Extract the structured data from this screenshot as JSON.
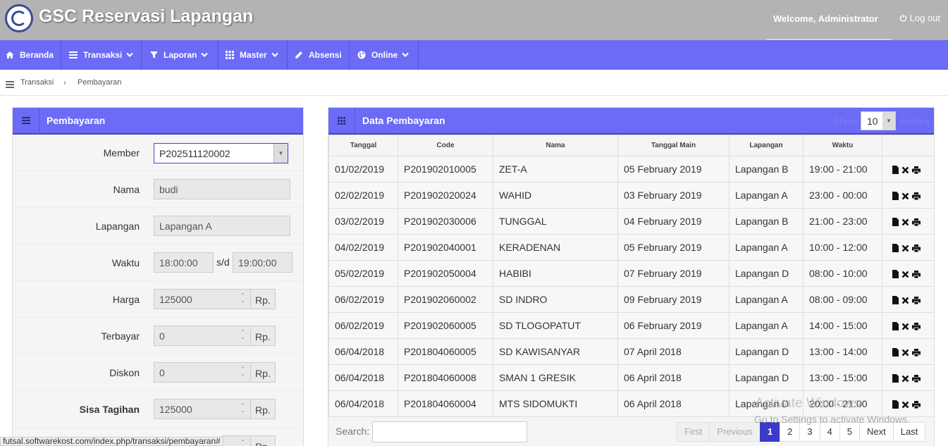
{
  "app": {
    "title": "GSC Reservasi Lapangan",
    "welcome": "Welcome, Administrator",
    "logout": "Log out"
  },
  "nav": [
    {
      "label": "Beranda",
      "icon": "home-icon"
    },
    {
      "label": "Transaksi",
      "icon": "list-icon"
    },
    {
      "label": "Laporan",
      "icon": "filter-icon"
    },
    {
      "label": "Master",
      "icon": "grid-icon"
    },
    {
      "label": "Absensi",
      "icon": "pencil-icon"
    },
    {
      "label": "Online",
      "icon": "globe-icon"
    }
  ],
  "breadcrumb": [
    "Transaksi",
    "Pembayaran"
  ],
  "form": {
    "title": "Pembayaran",
    "member_label": "Member",
    "member_value": "P202511120002",
    "nama_label": "Nama",
    "nama_value": "budi",
    "lapangan_label": "Lapangan",
    "lapangan_value": "Lapangan A",
    "waktu_label": "Waktu",
    "waktu_from": "18:00:00",
    "waktu_sep": "s/d",
    "waktu_to": "19:00:00",
    "harga_label": "Harga",
    "harga_value": "125000",
    "terbayar_label": "Terbayar",
    "terbayar_value": "0",
    "diskon_label": "Diskon",
    "diskon_value": "0",
    "sisa_label": "Sisa Tagihan",
    "sisa_value": "125000",
    "currency": "Rp."
  },
  "data_table": {
    "title": "Data Pembayaran",
    "show_label": "Show",
    "entries_label": "entries",
    "page_size": "10",
    "columns": [
      "Tanggal",
      "Code",
      "Nama",
      "Tanggal Main",
      "Lapangan",
      "Waktu",
      ""
    ],
    "rows": [
      [
        "01/02/2019",
        "P201902010005",
        "ZET-A",
        "05 February 2019",
        "Lapangan B",
        "19:00 - 21:00"
      ],
      [
        "02/02/2019",
        "P201902020024",
        "WAHID",
        "03 February 2019",
        "Lapangan A",
        "23:00 - 00:00"
      ],
      [
        "03/02/2019",
        "P201902030006",
        "TUNGGAL",
        "04 February 2019",
        "Lapangan B",
        "21:00 - 23:00"
      ],
      [
        "04/02/2019",
        "P201902040001",
        "KERADENAN",
        "05 February 2019",
        "Lapangan A",
        "10:00 - 12:00"
      ],
      [
        "05/02/2019",
        "P201902050004",
        "HABIBI",
        "07 February 2019",
        "Lapangan D",
        "08:00 - 10:00"
      ],
      [
        "06/02/2019",
        "P201902060002",
        "SD INDRO",
        "09 February 2019",
        "Lapangan A",
        "08:00 - 09:00"
      ],
      [
        "06/02/2019",
        "P201902060005",
        "SD TLOGOPATUT",
        "06 February 2019",
        "Lapangan A",
        "14:00 - 15:00"
      ],
      [
        "06/04/2018",
        "P201804060005",
        "SD KAWISANYAR",
        "07 April 2018",
        "Lapangan D",
        "13:00 - 14:00"
      ],
      [
        "06/04/2018",
        "P201804060008",
        "SMAN 1 GRESIK",
        "06 April 2018",
        "Lapangan D",
        "13:00 - 15:00"
      ],
      [
        "06/04/2018",
        "P201804060004",
        "MTS SIDOMUKTI",
        "06 April 2018",
        "Lapangan D",
        "20:00 - 21:00"
      ]
    ],
    "search_label": "Search:",
    "pager": [
      "First",
      "Previous",
      "1",
      "2",
      "3",
      "4",
      "5",
      "Next",
      "Last"
    ],
    "active_page": "1"
  },
  "watermark": {
    "line1": "Activate Windows",
    "line2": "Go to Settings to activate Windows."
  },
  "status_url": "futsal.softwarekost.com/index.php/transaksi/pembayaran#"
}
